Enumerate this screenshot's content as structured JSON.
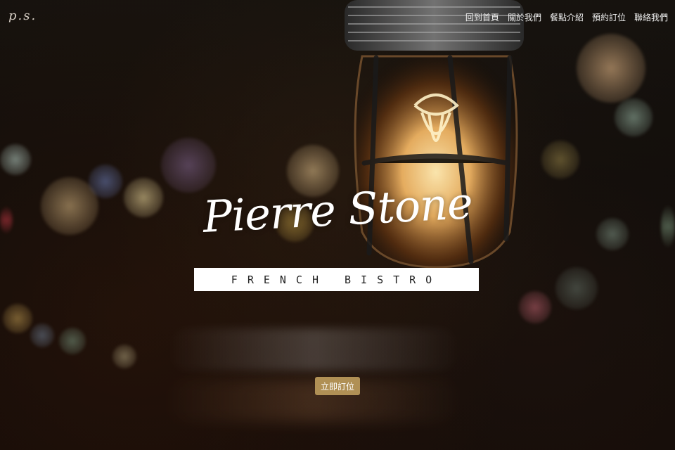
{
  "site": {
    "logo_text": "p.s."
  },
  "nav": {
    "items": [
      {
        "label": "回到首頁"
      },
      {
        "label": "關於我們"
      },
      {
        "label": "餐點介紹"
      },
      {
        "label": "預約訂位"
      },
      {
        "label": "聯絡我們"
      }
    ]
  },
  "hero": {
    "script_title": "Pierre Stone",
    "tagline": "FRENCH BISTRO",
    "cta_label": "立即訂位"
  },
  "colors": {
    "cta": "#b09055",
    "nav_text": "#f0f0f0",
    "tagline_bg": "#ffffff"
  },
  "icons": {
    "lamp": "vintage-cage-lamp-icon"
  }
}
